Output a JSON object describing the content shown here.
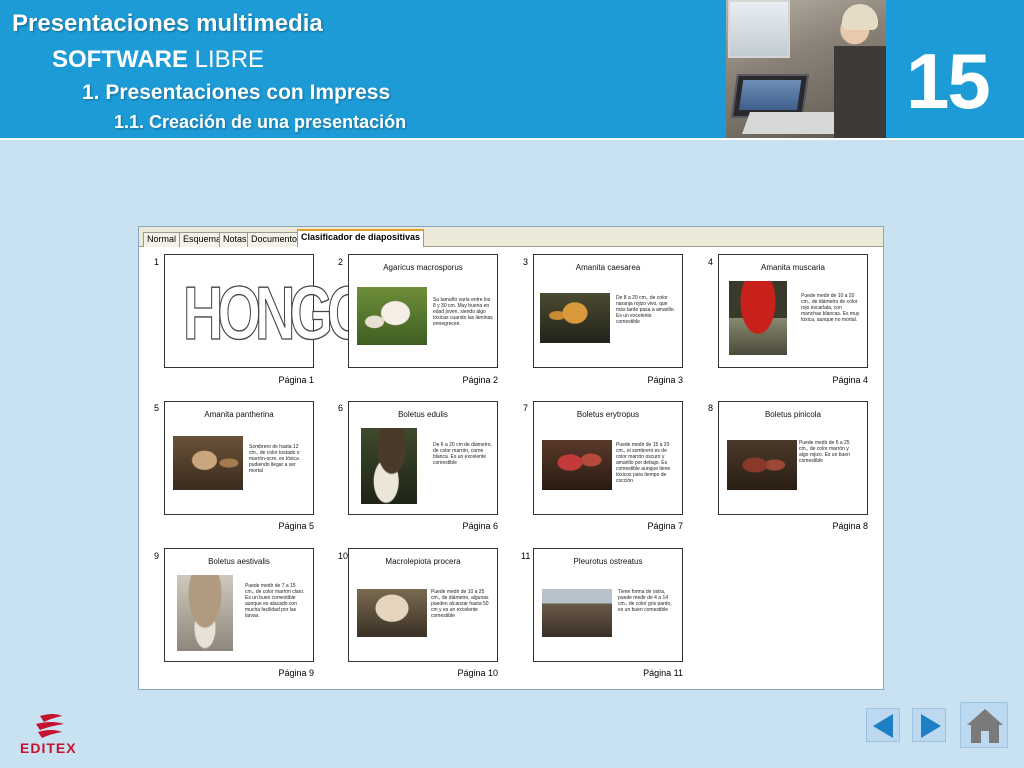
{
  "header": {
    "title": "Presentaciones multimedia",
    "subtitle_bold": "SOFTWARE",
    "subtitle_rest": " LIBRE",
    "section": "1.  Presentaciones con Impress",
    "subsection": "1.1. Creación de una presentación",
    "slide_number": "15"
  },
  "tabs": [
    {
      "label": "Normal",
      "active": false
    },
    {
      "label": "Esquema",
      "active": false
    },
    {
      "label": "Notas",
      "active": false
    },
    {
      "label": "Documento",
      "active": false
    },
    {
      "label": "Clasificador de diapositivas",
      "active": true
    }
  ],
  "slides": [
    {
      "num": "1",
      "title": "",
      "big_text": "HONGOS",
      "page": "Página 1",
      "text": ""
    },
    {
      "num": "2",
      "title": "Agaricus macrosporus",
      "page": "Página 2",
      "text": "Su tamaño varía entre los 8 y 30 cm. Muy buena en edad joven, siendo algo tóxicas cuando las láminas ennegrecen."
    },
    {
      "num": "3",
      "title": "Amanita caesarea",
      "page": "Página 3",
      "text": "De 8 a 20 cm., de color naranja rojizo vivo, que más tarde pasa a amarillo. Es un excelente comestible"
    },
    {
      "num": "4",
      "title": "Amanita muscaria",
      "page": "Página 4",
      "text": "Puede medir de 10 a 20 cm., de diámetro de color rojo escarlata, con manchas blancas. Es muy tóxica, aunque no mortal."
    },
    {
      "num": "5",
      "title": "Amanita pantherina",
      "page": "Página 5",
      "text": "Sombrero de hasta 12 cm., de color tostado o marrón-ocre, es tóxica pudiendo llegar a ser mortal"
    },
    {
      "num": "6",
      "title": "Boletus edulis",
      "page": "Página 6",
      "text": "De 6 a 20 cm de diámetro, de color marrón, carne blanca. Es un excelente comestible"
    },
    {
      "num": "7",
      "title": "Boletus erytropus",
      "page": "Página 7",
      "text": "Puede medir de 15 a 20 cm., el sombrero es de color marrón oscuro y amarillo por debajo. Es comestible aunque tiene tóxicos para tiempo de cocción"
    },
    {
      "num": "8",
      "title": "Boletus pinicola",
      "page": "Página 8",
      "text": "Puede medir de 6 a 25 cm., de color marrón y algo rojizo. Es un buen comestible"
    },
    {
      "num": "9",
      "title": "Boletus aestivalis",
      "page": "Página 9",
      "text": "Puede medir de 7 a 15 cm., de color marrón claro. Es un buen comestible aunque es atacado con mucha facilidad por las larvas."
    },
    {
      "num": "10",
      "title": "Macrolepiota procera",
      "page": "Página 10",
      "text": "Puede medir de 10 a 25 cm., de diámetro, algunas pueden alcanzar hasta 50 cm y es un excelente comestible"
    },
    {
      "num": "11",
      "title": "Pleurotus ostreatus",
      "page": "Página 11",
      "text": "Tiene forma de ostra, puede medir de 4 a 14 cm., de color gris pardo, es un buen comestible"
    }
  ],
  "logo": {
    "text": "EDITEX"
  },
  "colors": {
    "header": "#1d9bd6",
    "background": "#c9e2f1",
    "logo": "#c4122f"
  },
  "nav": {
    "prev_icon": "triangle-left-icon",
    "next_icon": "triangle-right-icon",
    "home_icon": "home-icon"
  }
}
